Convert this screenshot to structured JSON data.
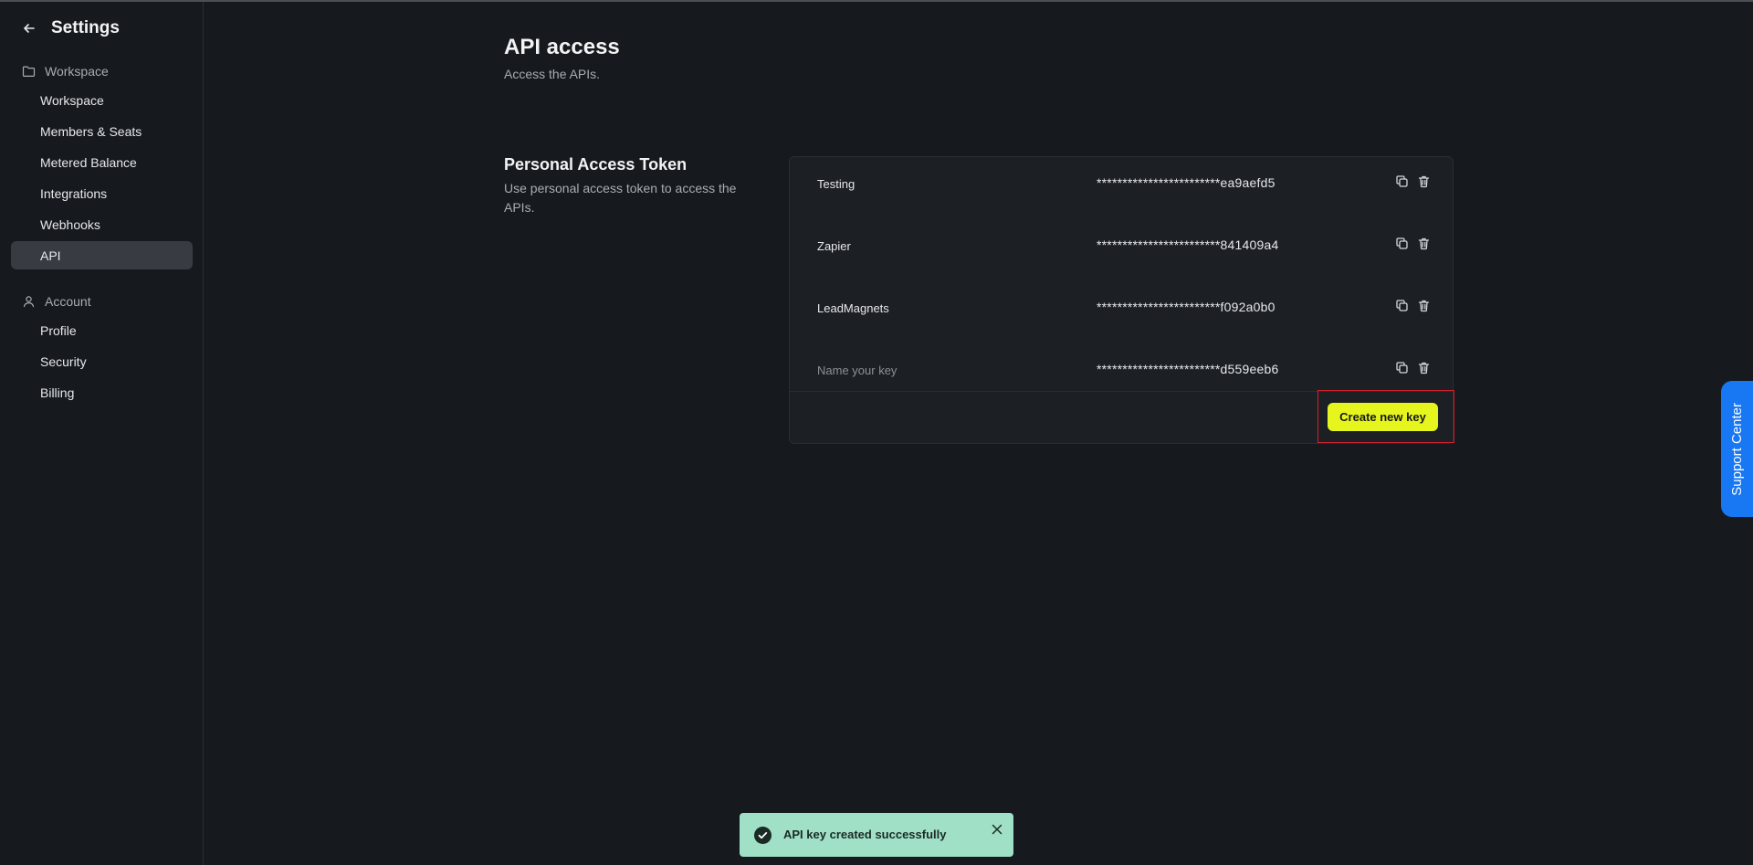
{
  "sidebar": {
    "title": "Settings",
    "groups": [
      {
        "label": "Workspace",
        "icon": "folder-icon",
        "items": [
          "Workspace",
          "Members & Seats",
          "Metered Balance",
          "Integrations",
          "Webhooks",
          "API"
        ]
      },
      {
        "label": "Account",
        "icon": "user-icon",
        "items": [
          "Profile",
          "Security",
          "Billing"
        ]
      }
    ],
    "active_item": "API"
  },
  "main": {
    "title": "API access",
    "subtitle": "Access the APIs.",
    "section": {
      "title": "Personal Access Token",
      "description": "Use personal access token to access the APIs.",
      "keys": [
        {
          "name": "Testing",
          "token": "************************ea9aefd5",
          "placeholder": false
        },
        {
          "name": "Zapier",
          "token": "************************841409a4",
          "placeholder": false
        },
        {
          "name": "LeadMagnets",
          "token": "************************f092a0b0",
          "placeholder": false
        },
        {
          "name": "Name your key",
          "token": "************************d559eeb6",
          "placeholder": true
        }
      ],
      "create_button": "Create new key"
    }
  },
  "support": {
    "label": "Support Center"
  },
  "toast": {
    "message": "API key created successfully"
  },
  "colors": {
    "background": "#16191d",
    "accent": "#e6f51d",
    "support": "#1877f2",
    "toast": "#9fe0c6",
    "highlight": "#d0202a"
  }
}
